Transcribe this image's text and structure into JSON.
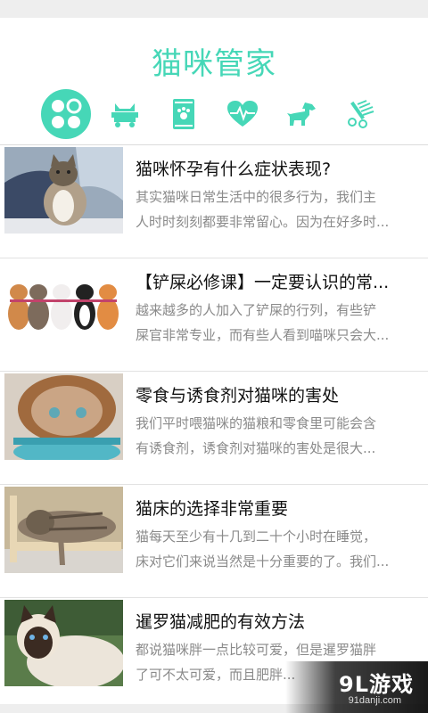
{
  "app": {
    "title": "猫咪管家"
  },
  "colors": {
    "accent": "#46d7b7"
  },
  "categories": [
    {
      "name": "grid-icon",
      "active": true
    },
    {
      "name": "cat-bed-icon",
      "active": false
    },
    {
      "name": "cat-food-icon",
      "active": false
    },
    {
      "name": "heartbeat-icon",
      "active": false
    },
    {
      "name": "dog-icon",
      "active": false
    },
    {
      "name": "grooming-comb-icon",
      "active": false
    }
  ],
  "articles": [
    {
      "title": "猫咪怀孕有什么症状表现?",
      "desc1": "其实猫咪日常生活中的很多行为，我们主",
      "desc2": "人时时刻刻都要非常留心。因为在好多时..."
    },
    {
      "title": "【铲屎必修课】一定要认识的常...",
      "desc1": "越来越多的人加入了铲屎的行列，有些铲",
      "desc2": "屎官非常专业，而有些人看到喵咪只会大..."
    },
    {
      "title": "零食与诱食剂对猫咪的害处",
      "desc1": "我们平时喂猫咪的猫粮和零食里可能会含",
      "desc2": "有诱食剂，诱食剂对猫咪的害处是很大..."
    },
    {
      "title": "猫床的选择非常重要",
      "desc1": "猫每天至少有十几到二十个小时在睡觉，",
      "desc2": "床对它们来说当然是十分重要的了。我们..."
    },
    {
      "title": "暹罗猫减肥的有效方法",
      "desc1": "都说猫咪胖一点比较可爱，但是暹罗猫胖",
      "desc2": "了可不太可爱，而且肥胖..."
    }
  ],
  "watermark": {
    "logo": "9L游戏",
    "site": "91danji.com"
  }
}
